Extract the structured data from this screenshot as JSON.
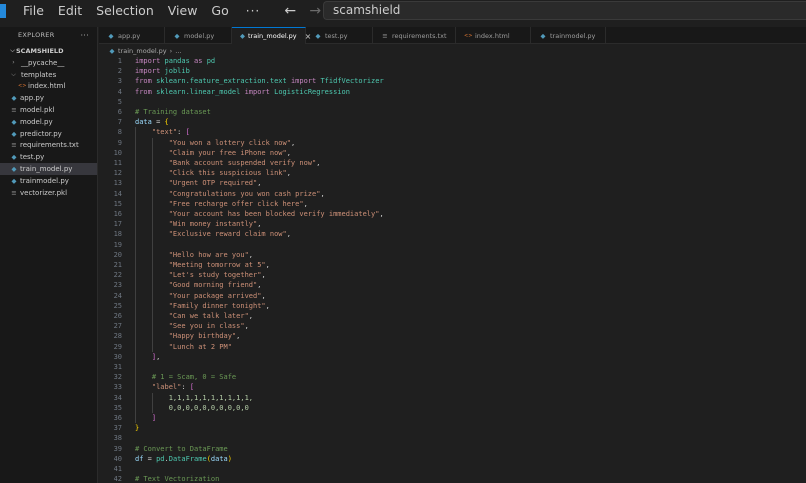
{
  "window": {
    "menus": [
      "File",
      "Edit",
      "Selection",
      "View",
      "Go"
    ],
    "more": "···",
    "search_text": "scamshield"
  },
  "explorer": {
    "header": "EXPLORER",
    "more": "···",
    "root": "SCAMSHIELD",
    "items": [
      {
        "label": "__pycache__",
        "type": "folder",
        "expanded": false,
        "depth": 1,
        "icon": "chevron-right"
      },
      {
        "label": "templates",
        "type": "folder",
        "expanded": true,
        "depth": 1,
        "icon": "chevron-down"
      },
      {
        "label": "index.html",
        "type": "html",
        "depth": 2,
        "icon": "html-file-icon"
      },
      {
        "label": "app.py",
        "type": "py",
        "depth": 1,
        "icon": "python-file-icon"
      },
      {
        "label": "model.pkl",
        "type": "pkl",
        "depth": 1,
        "icon": "binary-file-icon"
      },
      {
        "label": "model.py",
        "type": "py",
        "depth": 1,
        "icon": "python-file-icon"
      },
      {
        "label": "predictor.py",
        "type": "py",
        "depth": 1,
        "icon": "python-file-icon"
      },
      {
        "label": "requirements.txt",
        "type": "txt",
        "depth": 1,
        "icon": "text-file-icon"
      },
      {
        "label": "test.py",
        "type": "py",
        "depth": 1,
        "icon": "python-file-icon"
      },
      {
        "label": "train_model.py",
        "type": "py",
        "depth": 1,
        "icon": "python-file-icon",
        "selected": true
      },
      {
        "label": "trainmodel.py",
        "type": "py",
        "depth": 1,
        "icon": "python-file-icon"
      },
      {
        "label": "vectorizer.pkl",
        "type": "pkl",
        "depth": 1,
        "icon": "binary-file-icon"
      }
    ]
  },
  "tabs": [
    {
      "label": "app.py",
      "type": "py"
    },
    {
      "label": "model.py",
      "type": "py"
    },
    {
      "label": "train_model.py",
      "type": "py",
      "active": true,
      "close": "×"
    },
    {
      "label": "test.py",
      "type": "py"
    },
    {
      "label": "requirements.txt",
      "type": "txt"
    },
    {
      "label": "index.html",
      "type": "html"
    },
    {
      "label": "trainmodel.py",
      "type": "py"
    }
  ],
  "breadcrumb": {
    "file": "train_model.py",
    "separator": "›",
    "tail": "..."
  },
  "editor": {
    "lines": [
      {
        "n": "1",
        "tokens": [
          [
            "kw",
            "import"
          ],
          [
            "pl",
            " "
          ],
          [
            "cls",
            "pandas"
          ],
          [
            "pl",
            " "
          ],
          [
            "kw",
            "as"
          ],
          [
            "pl",
            " "
          ],
          [
            "cls",
            "pd"
          ]
        ]
      },
      {
        "n": "2",
        "tokens": [
          [
            "kw",
            "import"
          ],
          [
            "pl",
            " "
          ],
          [
            "cls",
            "joblib"
          ]
        ]
      },
      {
        "n": "3",
        "tokens": [
          [
            "kw",
            "from"
          ],
          [
            "pl",
            " "
          ],
          [
            "cls",
            "sklearn.feature_extraction.text"
          ],
          [
            "pl",
            " "
          ],
          [
            "kw",
            "import"
          ],
          [
            "pl",
            " "
          ],
          [
            "cls",
            "TfidfVectorizer"
          ]
        ]
      },
      {
        "n": "4",
        "tokens": [
          [
            "kw",
            "from"
          ],
          [
            "pl",
            " "
          ],
          [
            "cls",
            "sklearn.linear_model"
          ],
          [
            "pl",
            " "
          ],
          [
            "kw",
            "import"
          ],
          [
            "pl",
            " "
          ],
          [
            "cls",
            "LogisticRegression"
          ]
        ]
      },
      {
        "n": "5",
        "tokens": []
      },
      {
        "n": "6",
        "tokens": [
          [
            "cm",
            "# Training dataset"
          ]
        ]
      },
      {
        "n": "7",
        "tokens": [
          [
            "var",
            "data"
          ],
          [
            "op",
            " = "
          ],
          [
            "br1",
            "{"
          ]
        ]
      },
      {
        "n": "8",
        "tokens": [
          [
            "pl",
            "    "
          ],
          [
            "str",
            "\"text\""
          ],
          [
            "pl",
            ": "
          ],
          [
            "br2",
            "["
          ]
        ]
      },
      {
        "n": "9",
        "tokens": [
          [
            "pl",
            "        "
          ],
          [
            "str",
            "\"You won a lottery click now\""
          ],
          [
            "pl",
            ","
          ]
        ]
      },
      {
        "n": "10",
        "tokens": [
          [
            "pl",
            "        "
          ],
          [
            "str",
            "\"Claim your free iPhone now\""
          ],
          [
            "pl",
            ","
          ]
        ]
      },
      {
        "n": "11",
        "tokens": [
          [
            "pl",
            "        "
          ],
          [
            "str",
            "\"Bank account suspended verify now\""
          ],
          [
            "pl",
            ","
          ]
        ]
      },
      {
        "n": "12",
        "tokens": [
          [
            "pl",
            "        "
          ],
          [
            "str",
            "\"Click this suspicious link\""
          ],
          [
            "pl",
            ","
          ]
        ]
      },
      {
        "n": "13",
        "tokens": [
          [
            "pl",
            "        "
          ],
          [
            "str",
            "\"Urgent OTP required\""
          ],
          [
            "pl",
            ","
          ]
        ]
      },
      {
        "n": "14",
        "tokens": [
          [
            "pl",
            "        "
          ],
          [
            "str",
            "\"Congratulations you won cash prize\""
          ],
          [
            "pl",
            ","
          ]
        ]
      },
      {
        "n": "15",
        "tokens": [
          [
            "pl",
            "        "
          ],
          [
            "str",
            "\"Free recharge offer click here\""
          ],
          [
            "pl",
            ","
          ]
        ]
      },
      {
        "n": "16",
        "tokens": [
          [
            "pl",
            "        "
          ],
          [
            "str",
            "\"Your account has been blocked verify immediately\""
          ],
          [
            "pl",
            ","
          ]
        ]
      },
      {
        "n": "17",
        "tokens": [
          [
            "pl",
            "        "
          ],
          [
            "str",
            "\"Win money instantly\""
          ],
          [
            "pl",
            ","
          ]
        ]
      },
      {
        "n": "18",
        "tokens": [
          [
            "pl",
            "        "
          ],
          [
            "str",
            "\"Exclusive reward claim now\""
          ],
          [
            "pl",
            ","
          ]
        ]
      },
      {
        "n": "19",
        "tokens": []
      },
      {
        "n": "20",
        "tokens": [
          [
            "pl",
            "        "
          ],
          [
            "str",
            "\"Hello how are you\""
          ],
          [
            "pl",
            ","
          ]
        ]
      },
      {
        "n": "21",
        "tokens": [
          [
            "pl",
            "        "
          ],
          [
            "str",
            "\"Meeting tomorrow at 5\""
          ],
          [
            "pl",
            ","
          ]
        ]
      },
      {
        "n": "22",
        "tokens": [
          [
            "pl",
            "        "
          ],
          [
            "str",
            "\"Let's study together\""
          ],
          [
            "pl",
            ","
          ]
        ]
      },
      {
        "n": "23",
        "tokens": [
          [
            "pl",
            "        "
          ],
          [
            "str",
            "\"Good morning friend\""
          ],
          [
            "pl",
            ","
          ]
        ]
      },
      {
        "n": "24",
        "tokens": [
          [
            "pl",
            "        "
          ],
          [
            "str",
            "\"Your package arrived\""
          ],
          [
            "pl",
            ","
          ]
        ]
      },
      {
        "n": "25",
        "tokens": [
          [
            "pl",
            "        "
          ],
          [
            "str",
            "\"Family dinner tonight\""
          ],
          [
            "pl",
            ","
          ]
        ]
      },
      {
        "n": "26",
        "tokens": [
          [
            "pl",
            "        "
          ],
          [
            "str",
            "\"Can we talk later\""
          ],
          [
            "pl",
            ","
          ]
        ]
      },
      {
        "n": "27",
        "tokens": [
          [
            "pl",
            "        "
          ],
          [
            "str",
            "\"See you in class\""
          ],
          [
            "pl",
            ","
          ]
        ]
      },
      {
        "n": "28",
        "tokens": [
          [
            "pl",
            "        "
          ],
          [
            "str",
            "\"Happy birthday\""
          ],
          [
            "pl",
            ","
          ]
        ]
      },
      {
        "n": "29",
        "tokens": [
          [
            "pl",
            "        "
          ],
          [
            "str",
            "\"Lunch at 2 PM\""
          ]
        ]
      },
      {
        "n": "30",
        "tokens": [
          [
            "pl",
            "    "
          ],
          [
            "br2",
            "]"
          ],
          [
            "pl",
            ","
          ]
        ]
      },
      {
        "n": "31",
        "tokens": []
      },
      {
        "n": "32",
        "tokens": [
          [
            "pl",
            "    "
          ],
          [
            "cm",
            "# 1 = Scam, 0 = Safe"
          ]
        ]
      },
      {
        "n": "33",
        "tokens": [
          [
            "pl",
            "    "
          ],
          [
            "str",
            "\"label\""
          ],
          [
            "pl",
            ": "
          ],
          [
            "br2",
            "["
          ]
        ]
      },
      {
        "n": "34",
        "tokens": [
          [
            "pl",
            "        "
          ],
          [
            "num",
            "1,1,1,1,1,1,1,1,1,1,"
          ]
        ]
      },
      {
        "n": "35",
        "tokens": [
          [
            "pl",
            "        "
          ],
          [
            "num",
            "0,0,0,0,0,0,0,0,0,0"
          ]
        ]
      },
      {
        "n": "36",
        "tokens": [
          [
            "pl",
            "    "
          ],
          [
            "br2",
            "]"
          ]
        ]
      },
      {
        "n": "37",
        "tokens": [
          [
            "br1",
            "}"
          ]
        ]
      },
      {
        "n": "38",
        "tokens": []
      },
      {
        "n": "39",
        "tokens": [
          [
            "cm",
            "# Convert to DataFrame"
          ]
        ]
      },
      {
        "n": "40",
        "tokens": [
          [
            "var",
            "df"
          ],
          [
            "op",
            " = "
          ],
          [
            "cls",
            "pd"
          ],
          [
            "pl",
            "."
          ],
          [
            "cls",
            "DataFrame"
          ],
          [
            "br1",
            "("
          ],
          [
            "var",
            "data"
          ],
          [
            "br1",
            ")"
          ]
        ]
      },
      {
        "n": "41",
        "tokens": []
      },
      {
        "n": "42",
        "tokens": [
          [
            "cm",
            "# Text Vectorization"
          ]
        ]
      }
    ]
  },
  "colors": {
    "accent": "#0078d4",
    "logo": "#2489db",
    "background": "#1f1f1f",
    "sidebar": "#181818"
  }
}
